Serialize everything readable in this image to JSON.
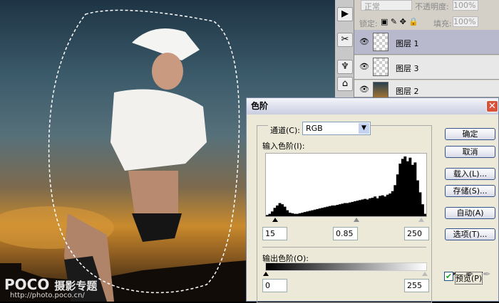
{
  "watermark": {
    "brand": "POCO",
    "text": "摄影专题",
    "url": "http://photo.poco.cn/"
  },
  "layers_panel": {
    "blend_mode": "正常",
    "opacity_label": "不透明度:",
    "opacity": "100%",
    "lock_label": "锁定:",
    "fill_label": "填充:",
    "fill": "100%",
    "layers": [
      {
        "name": "图层 1",
        "selected": true
      },
      {
        "name": "图层 3",
        "selected": false
      },
      {
        "name": "图层 2",
        "selected": false
      }
    ]
  },
  "levels_dialog": {
    "title": "色阶",
    "close": "✕",
    "channel_label": "通道(C):",
    "channel": "RGB",
    "input_label": "输入色阶(I):",
    "input_black": "15",
    "input_gamma": "0.85",
    "input_white": "250",
    "output_label": "输出色阶(O):",
    "output_black": "0",
    "output_white": "255",
    "buttons": {
      "ok": "确定",
      "cancel": "取消",
      "load": "载入(L)...",
      "save": "存储(S)...",
      "auto": "自动(A)",
      "options": "选项(T)..."
    },
    "preview_label": "预览(P)",
    "preview_checked": true,
    "histogram": [
      2,
      4,
      8,
      14,
      18,
      22,
      20,
      16,
      10,
      6,
      5,
      4,
      4,
      5,
      6,
      7,
      8,
      9,
      10,
      11,
      12,
      13,
      14,
      15,
      16,
      17,
      18,
      18,
      19,
      20,
      21,
      22,
      22,
      23,
      24,
      25,
      26,
      27,
      28,
      29,
      28,
      30,
      31,
      33,
      30,
      34,
      35,
      33,
      36,
      38,
      42,
      52,
      70,
      88,
      96,
      100,
      92,
      98,
      86,
      90,
      60,
      40,
      20,
      4
    ]
  }
}
